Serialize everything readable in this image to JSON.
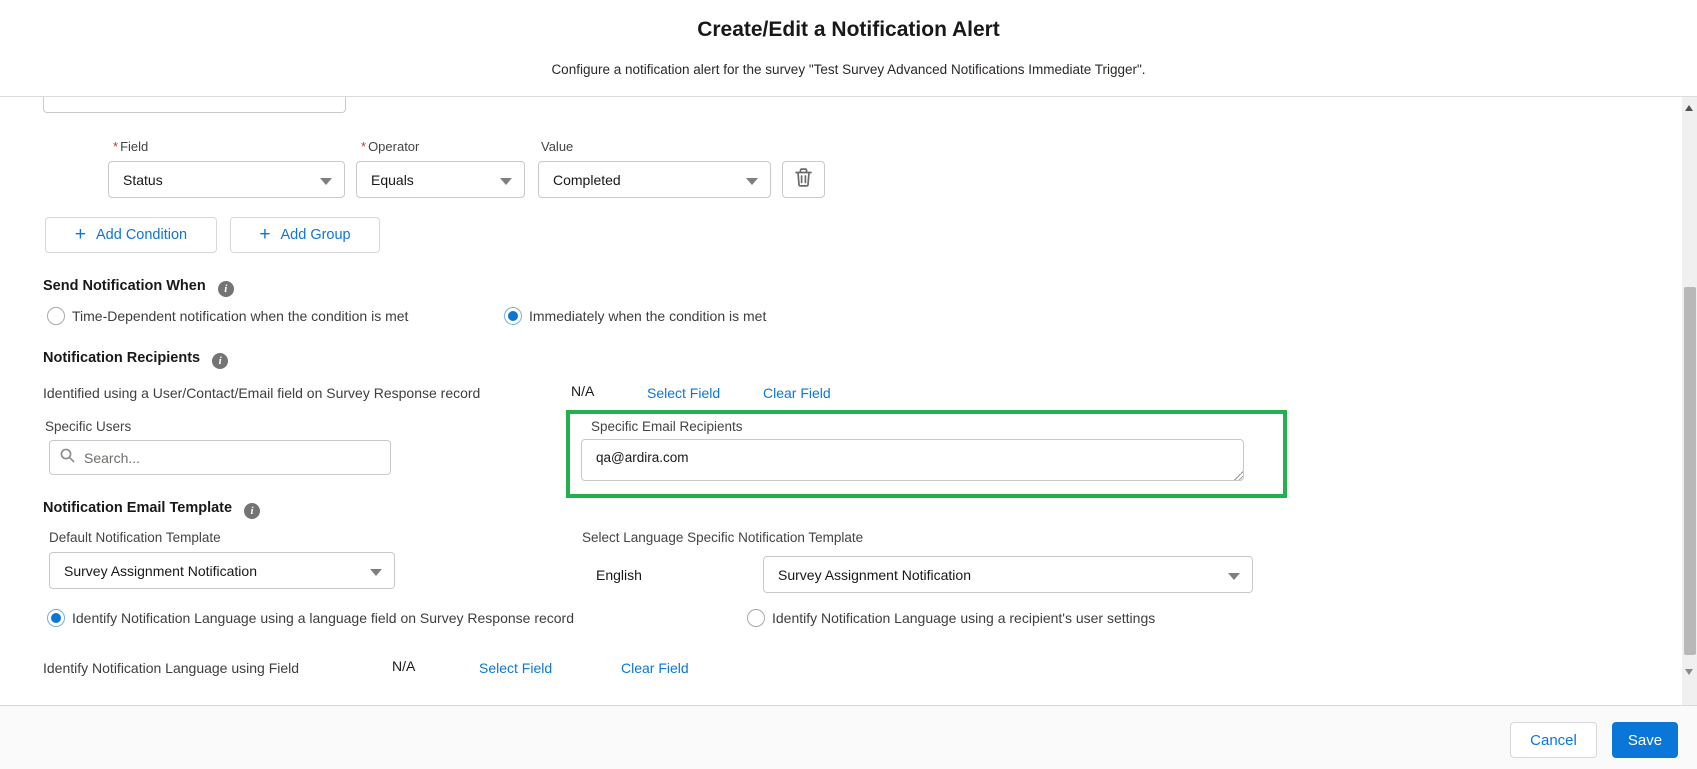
{
  "header": {
    "title": "Create/Edit a Notification Alert",
    "subtitle": "Configure a notification alert for the survey \"Test Survey Advanced Notifications Immediate Trigger\"."
  },
  "condition": {
    "required_marker": "*",
    "field_label": "Field",
    "operator_label": "Operator",
    "value_label": "Value",
    "field_value": "Status",
    "operator_value": "Equals",
    "value_value": "Completed",
    "delete_icon": "trash-icon",
    "plus": "+",
    "add_condition_label": "Add Condition",
    "add_group_label": "Add Group"
  },
  "send_when": {
    "heading": "Send Notification When",
    "options": [
      {
        "label": "Time-Dependent notification when the condition is met",
        "selected": false
      },
      {
        "label": "Immediately when the condition is met",
        "selected": true
      }
    ]
  },
  "recipients": {
    "heading": "Notification Recipients",
    "identified_label": "Identified using a User/Contact/Email field on Survey Response record",
    "identified_value": "N/A",
    "select_field_label": "Select Field",
    "clear_field_label": "Clear Field",
    "specific_users_label": "Specific Users",
    "search_placeholder": "Search...",
    "specific_email_label": "Specific Email Recipients",
    "specific_email_value": "qa@ardira.com"
  },
  "template": {
    "heading": "Notification Email Template",
    "default_label": "Default Notification Template",
    "default_value": "Survey Assignment Notification",
    "language_select_label": "Select Language Specific Notification Template",
    "language_name": "English",
    "language_template_value": "Survey Assignment Notification",
    "options": [
      {
        "label": "Identify Notification Language using a language field on Survey Response record",
        "selected": true
      },
      {
        "label": "Identify Notification Language using a recipient's user settings",
        "selected": false
      }
    ],
    "identify_field_label": "Identify Notification Language using Field",
    "identify_field_value": "N/A",
    "select_field_label": "Select Field",
    "clear_field_label": "Clear Field"
  },
  "footer": {
    "cancel_label": "Cancel",
    "save_label": "Save"
  },
  "colors": {
    "accent_blue": "#0b76db",
    "save_blue": "#0a76d8",
    "highlight_green": "#22b14c",
    "required_red": "#c23934",
    "radio_selected_blue": "#0b76d3"
  }
}
